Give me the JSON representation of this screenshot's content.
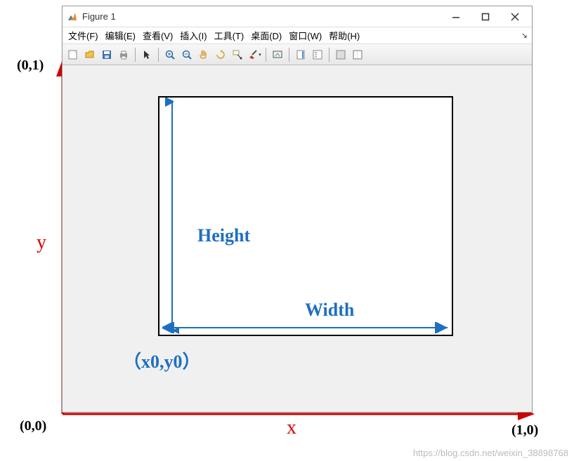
{
  "window": {
    "title": "Figure 1"
  },
  "menu": {
    "file": "文件(F)",
    "edit": "编辑(E)",
    "view": "查看(V)",
    "insert": "插入(I)",
    "tools": "工具(T)",
    "desktop": "桌面(D)",
    "window": "窗口(W)",
    "help": "帮助(H)"
  },
  "labels": {
    "height": "Height",
    "width": "Width",
    "origin": "（x0,y0）",
    "y_axis": "y",
    "x_axis": "x"
  },
  "corners": {
    "top_left": "(0,1)",
    "bottom_left": "(0,0)",
    "bottom_right": "(1,0)"
  },
  "watermark": "https://blog.csdn.net/weixin_38898768",
  "colors": {
    "axis": "#d00000",
    "arrow": "#1f6fc0"
  }
}
